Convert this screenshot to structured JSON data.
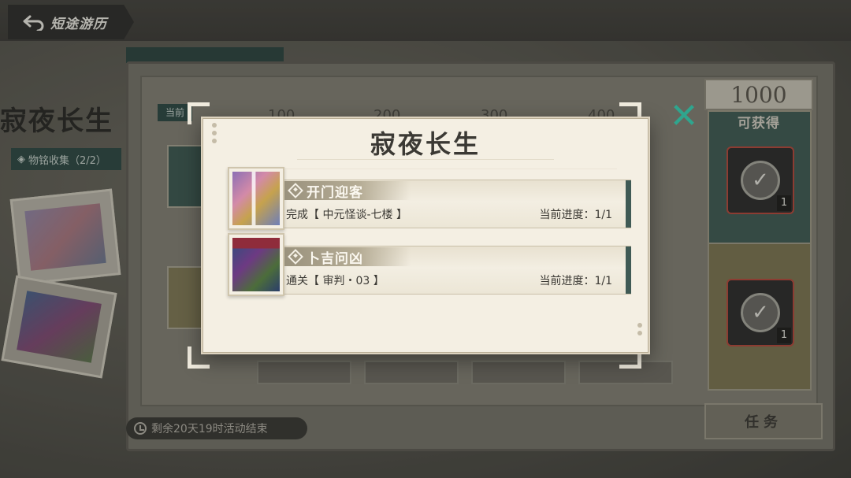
{
  "header": {
    "back_label": "短途游历"
  },
  "background": {
    "title": "寂夜长生",
    "collection_tag": "物铭收集（2/2）",
    "current_tag": "当前",
    "milestones": [
      "100",
      "200",
      "300",
      "400"
    ],
    "timer_text": "剩余20天19时活动结束",
    "task_button": "任务",
    "reward_count": "1000",
    "obtainable_label": "可获得",
    "reward_slots": [
      {
        "qty": "1"
      },
      {
        "qty": "1"
      }
    ]
  },
  "modal": {
    "title": "寂夜长生",
    "items": [
      {
        "name": "开门迎客",
        "description": "完成【 中元怪谈-七楼 】",
        "progress": "当前进度：1/1"
      },
      {
        "name": "卜吉问凶",
        "description": "通关【 审判・03 】",
        "progress": "当前进度：1/1"
      }
    ]
  },
  "colors": {
    "accent_teal": "#2fa58e",
    "item_edge": "#3f5a55",
    "modal_bg": "#f4efe3"
  }
}
